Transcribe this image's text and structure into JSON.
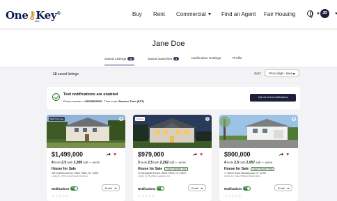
{
  "nav": {
    "logo_text": "One",
    "logo_key": "Key",
    "logo_sub": "MLS",
    "links": [
      {
        "label": "Buy",
        "dropdown": false
      },
      {
        "label": "Rent",
        "dropdown": false
      },
      {
        "label": "Commercial",
        "dropdown": true
      },
      {
        "label": "Find an Agent",
        "dropdown": false
      },
      {
        "label": "Fair Housing",
        "dropdown": false
      }
    ],
    "avatar_initials": "JD"
  },
  "profile": {
    "name": "Jane Doe",
    "tabs": [
      {
        "label": "Saved Listings",
        "count": "10",
        "active": true
      },
      {
        "label": "Saved Searches",
        "count": "3",
        "active": false
      },
      {
        "label": "Notification Settings",
        "count": "",
        "active": false
      },
      {
        "label": "Profile",
        "count": "",
        "active": false
      }
    ]
  },
  "listings_header": {
    "saved_count": "10",
    "saved_suffix": "saved listings",
    "sort_label": "Sort:",
    "sort_value": "Price (high - low)"
  },
  "notification_banner": {
    "title": "Text notifications are enabled",
    "phone_label": "Phone number:",
    "phone": "+15555555555",
    "timezone_label": "Time zone:",
    "timezone": "Eastern Time (EST)",
    "optout_label": "Opt out of text notifications"
  },
  "cards": [
    {
      "badge": "NEW 3 hrs ago",
      "price": "$1,499,000",
      "beds": "4",
      "beds_label": "beds",
      "baths": "2.5",
      "baths_label": "bath",
      "sqft": "3,300",
      "sqft_label": "sqft",
      "acres_label": "— acres",
      "status": "House for Sale",
      "down_payment": "",
      "address": "484 Seaview Avenue, White Plains, NY 10605",
      "agent": "Listing by: OKA Irvine Realty Services",
      "notifications_label": "Notifications",
      "toggle_label": "ON",
      "email_label": "Email"
    },
    {
      "badge": "Pending",
      "price": "$979,000",
      "beds": "3",
      "beds_label": "beds",
      "baths": "2.5",
      "baths_label": "bath",
      "sqft": "2,262",
      "sqft_label": "sqft",
      "acres_label": "— acres",
      "status": "House for Sale",
      "down_payment": "Down Payment Help",
      "address": "24 Springdale Avenue, White Plains, NY 10604",
      "agent": "Listing by: Houlihan Lawrence Inc.",
      "notifications_label": "Notifications",
      "toggle_label": "ON",
      "email_label": "Email"
    },
    {
      "badge": "",
      "price": "$900,000",
      "beds": "4",
      "beds_label": "beds",
      "baths": "2.5",
      "baths_label": "bath",
      "sqft": "2,057",
      "sqft_label": "sqft",
      "acres_label": "— acres",
      "status": "House for Sale",
      "down_payment": "Down Payment Help",
      "address": "77 Beech Road, Massapequa, NY 11758",
      "agent": "Listing by: Keller Williams Realty Elite",
      "notifications_label": "Notifications",
      "toggle_label": "ON",
      "email_label": "Email"
    }
  ],
  "colors": {
    "brand_navy": "#0a1c4a",
    "button_dark": "#1b1f3b",
    "toggle_green": "#2e7d32",
    "heart_red": "#d32f2f"
  },
  "icons": [
    "globe-icon",
    "check-circle-icon",
    "share-icon",
    "heart-icon",
    "close-icon",
    "chevron-down-icon",
    "star-icon"
  ]
}
